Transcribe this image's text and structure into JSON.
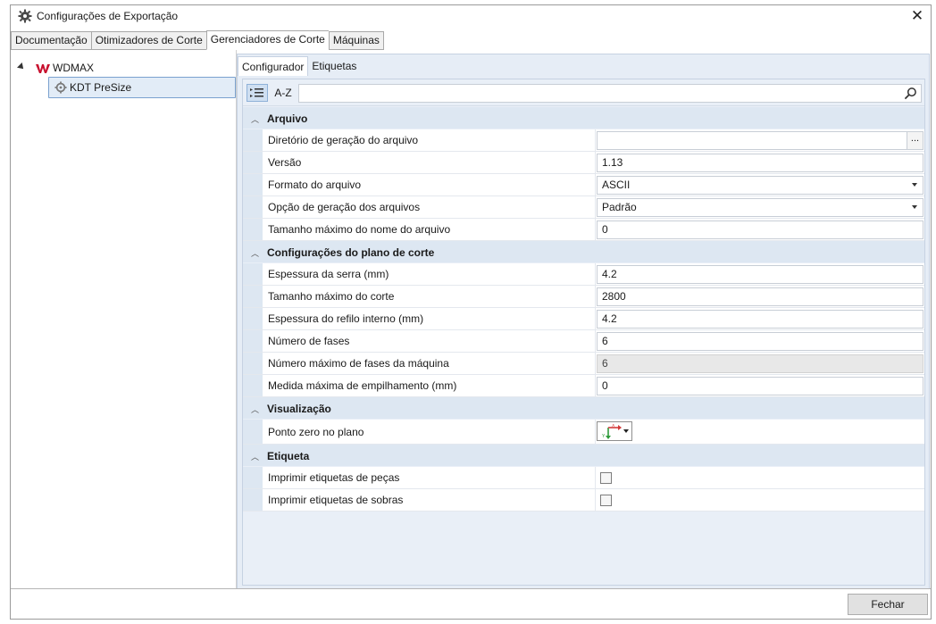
{
  "window": {
    "title": "Configurações de Exportação",
    "close_symbol": "✕"
  },
  "tabs": [
    {
      "label": "Documentação"
    },
    {
      "label": "Otimizadores de Corte"
    },
    {
      "label": "Gerenciadores de Corte"
    },
    {
      "label": "Máquinas"
    }
  ],
  "tree": {
    "root_label": "WDMAX",
    "child_label": "KDT PreSize"
  },
  "subtabs": [
    {
      "label": "Configurador"
    },
    {
      "label": "Etiquetas"
    }
  ],
  "toolbar": {
    "categorized_icon": "categorized-icon",
    "alpha_label": "A-Z",
    "search_value": ""
  },
  "categories": {
    "arquivo": {
      "label": "Arquivo",
      "rows": [
        {
          "name": "Diretório de geração do arquivo",
          "value": "",
          "ellipsis": "..."
        },
        {
          "name": "Versão",
          "value": "1.13"
        },
        {
          "name": "Formato do arquivo",
          "value": "ASCII"
        },
        {
          "name": "Opção de geração dos arquivos",
          "value": "Padrão"
        },
        {
          "name": "Tamanho máximo do nome do arquivo",
          "value": "0"
        }
      ]
    },
    "plano": {
      "label": "Configurações do plano de corte",
      "rows": [
        {
          "name": "Espessura da serra (mm)",
          "value": "4.2"
        },
        {
          "name": "Tamanho máximo do corte",
          "value": "2800"
        },
        {
          "name": "Espessura do refilo interno (mm)",
          "value": "4.2"
        },
        {
          "name": "Número de fases",
          "value": "6"
        },
        {
          "name": "Número máximo de fases da máquina",
          "value": "6"
        },
        {
          "name": "Medida máxima de empilhamento (mm)",
          "value": "0"
        }
      ]
    },
    "visualizacao": {
      "label": "Visualização",
      "rows": [
        {
          "name": "Ponto zero no plano",
          "icon": "axis-origin-icon",
          "axis_x": "X",
          "axis_y": "Y"
        }
      ]
    },
    "etiqueta": {
      "label": "Etiqueta",
      "rows": [
        {
          "name": "Imprimir etiquetas de peças",
          "checked": false
        },
        {
          "name": "Imprimir etiquetas de sobras",
          "checked": false
        }
      ]
    }
  },
  "footer": {
    "close_label": "Fechar"
  },
  "colors": {
    "accent_selected": "#e2ecf7",
    "category_bg": "#dde7f2",
    "logo_red": "#c8102e"
  }
}
